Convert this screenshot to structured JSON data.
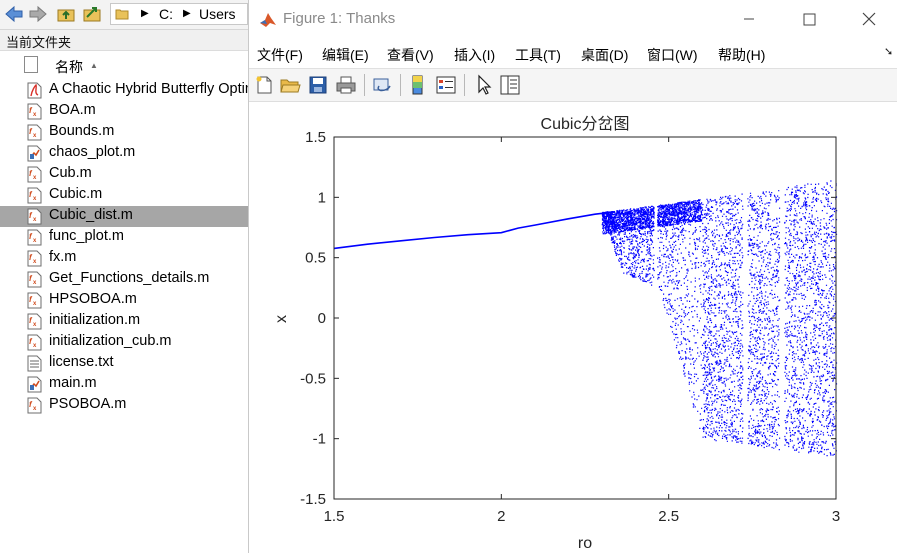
{
  "file_browser": {
    "path_parts": [
      "C:",
      "Users"
    ],
    "panel_title": "当前文件夹",
    "column_header": "名称",
    "files": [
      {
        "name": "A Chaotic Hybrid Butterfly Optimization",
        "type": "pdf"
      },
      {
        "name": "BOA.m",
        "type": "fx"
      },
      {
        "name": "Bounds.m",
        "type": "fx"
      },
      {
        "name": "chaos_plot.m",
        "type": "script"
      },
      {
        "name": "Cub.m",
        "type": "fx"
      },
      {
        "name": "Cubic.m",
        "type": "fx"
      },
      {
        "name": "Cubic_dist.m",
        "type": "fx",
        "selected": true
      },
      {
        "name": "func_plot.m",
        "type": "fx"
      },
      {
        "name": "fx.m",
        "type": "fx"
      },
      {
        "name": "Get_Functions_details.m",
        "type": "fx"
      },
      {
        "name": "HPSOBOA.m",
        "type": "fx"
      },
      {
        "name": "initialization.m",
        "type": "fx"
      },
      {
        "name": "initialization_cub.m",
        "type": "fx"
      },
      {
        "name": "license.txt",
        "type": "txt"
      },
      {
        "name": "main.m",
        "type": "script"
      },
      {
        "name": "PSOBOA.m",
        "type": "fx"
      }
    ]
  },
  "figure_window": {
    "title": "Figure 1: Thanks",
    "menu": [
      "文件(F)",
      "编辑(E)",
      "查看(V)",
      "插入(I)",
      "工具(T)",
      "桌面(D)",
      "窗口(W)",
      "帮助(H)"
    ],
    "toolbar_icons": [
      "new-figure-icon",
      "open-file-icon",
      "save-icon",
      "print-icon",
      "link-plot-icon",
      "insert-colorbar-icon",
      "insert-legend-icon",
      "edit-plot-icon",
      "property-inspector-icon"
    ]
  },
  "chart_data": {
    "type": "scatter",
    "title": "Cubic分岔图",
    "xlabel": "ro",
    "ylabel": "x",
    "xlim": [
      1.5,
      3
    ],
    "ylim": [
      -1.5,
      1.5
    ],
    "xticks": [
      "1.5",
      "2",
      "2.5",
      "3"
    ],
    "yticks": [
      "1.5",
      "1",
      "0.5",
      "0",
      "-0.5",
      "-1",
      "-1.5"
    ],
    "marker_color": "#0000ff",
    "grid": false,
    "series": [
      {
        "branch": "stable",
        "points": [
          [
            1.5,
            0.577
          ],
          [
            1.6,
            0.612
          ],
          [
            1.7,
            0.64
          ],
          [
            1.8,
            0.667
          ],
          [
            1.9,
            0.69
          ],
          [
            2.0,
            0.707
          ],
          [
            2.05,
            0.745
          ],
          [
            2.1,
            0.77
          ],
          [
            2.2,
            0.822
          ],
          [
            2.28,
            0.86
          ],
          [
            2.34,
            0.88
          ]
        ]
      },
      {
        "branch": "chaotic",
        "x_range": [
          2.3,
          3.0
        ],
        "upper_envelope": [
          [
            2.3,
            0.88
          ],
          [
            2.5,
            0.95
          ],
          [
            2.75,
            1.05
          ],
          [
            3.0,
            1.15
          ]
        ],
        "lower_envelope": [
          [
            2.3,
            0.86
          ],
          [
            2.36,
            0.38
          ],
          [
            2.47,
            0.25
          ],
          [
            2.6,
            -1.0
          ],
          [
            3.0,
            -1.15
          ]
        ],
        "windows": [
          [
            2.455,
            2.465
          ],
          [
            2.72,
            2.735
          ],
          [
            2.83,
            2.845
          ]
        ]
      }
    ]
  }
}
